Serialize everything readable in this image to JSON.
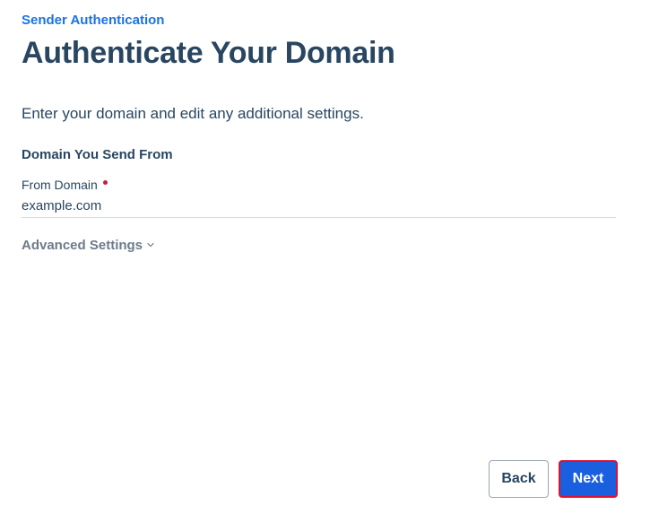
{
  "header": {
    "eyebrow": "Sender Authentication",
    "title": "Authenticate Your Domain"
  },
  "intro": "Enter your domain and edit any additional settings.",
  "domain_section": {
    "heading": "Domain You Send From",
    "from_domain": {
      "label": "From Domain",
      "required": true,
      "placeholder": "example.com",
      "value": ""
    }
  },
  "advanced_settings": {
    "label": "Advanced Settings",
    "icon": "chevron-down-icon",
    "expanded": false
  },
  "footer": {
    "back_label": "Back",
    "next_label": "Next"
  },
  "colors": {
    "accent": "#1a73e8",
    "heading": "#294661",
    "primary_button": "#1a5fe0",
    "required": "#c41e3a",
    "highlight_border": "#e0102e"
  }
}
